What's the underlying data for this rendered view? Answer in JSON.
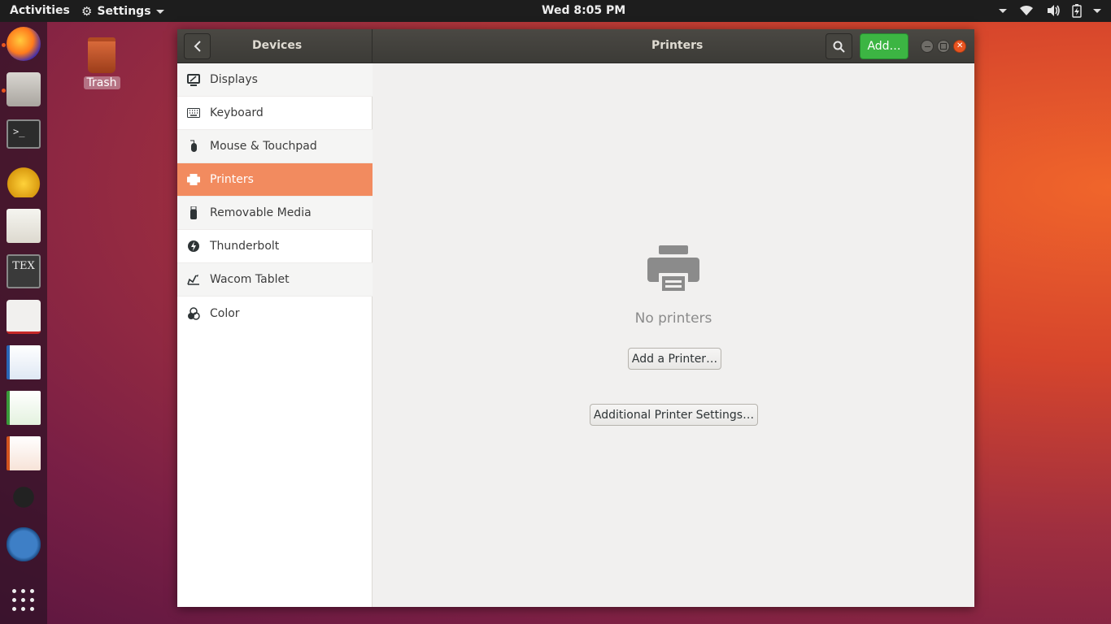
{
  "topbar": {
    "activities": "Activities",
    "app_menu": "Settings",
    "clock": "Wed  8:05 PM"
  },
  "desktop": {
    "trash_label": "Trash"
  },
  "dock": {
    "apps": [
      "firefox",
      "files",
      "terminal",
      "teapot-app",
      "text-editor",
      "texmaker",
      "document-viewer",
      "writer",
      "calc",
      "impress",
      "inkscape",
      "pencil-app"
    ]
  },
  "window": {
    "sidebar_title": "Devices",
    "panel_title": "Printers",
    "add_label": "Add…",
    "sidebar": {
      "items": [
        {
          "label": "Displays",
          "icon": "display-icon"
        },
        {
          "label": "Keyboard",
          "icon": "keyboard-icon"
        },
        {
          "label": "Mouse & Touchpad",
          "icon": "mouse-icon"
        },
        {
          "label": "Printers",
          "icon": "printer-icon",
          "active": true
        },
        {
          "label": "Removable Media",
          "icon": "usb-icon"
        },
        {
          "label": "Thunderbolt",
          "icon": "thunderbolt-icon"
        },
        {
          "label": "Wacom Tablet",
          "icon": "tablet-icon"
        },
        {
          "label": "Color",
          "icon": "color-icon"
        }
      ]
    },
    "content": {
      "empty_text": "No printers",
      "add_printer_button": "Add a Printer…",
      "additional_settings_button": "Additional Printer Settings…"
    }
  },
  "colors": {
    "accent": "#f28b5f",
    "add_button": "#3cb543",
    "close_button": "#e95420"
  }
}
